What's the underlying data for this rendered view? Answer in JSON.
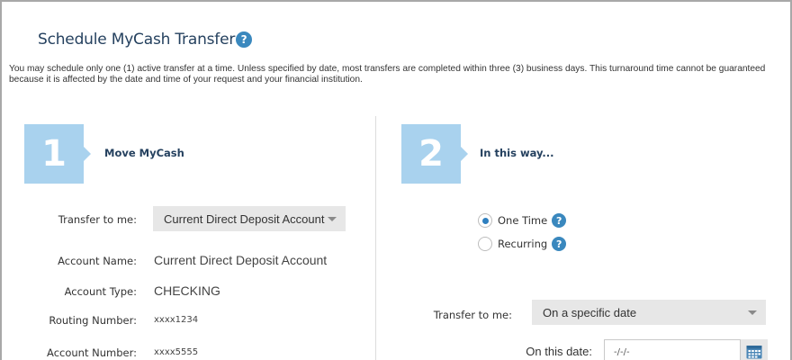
{
  "header": {
    "title": "Schedule MyCash Transfer",
    "help_glyph": "?"
  },
  "notice": "You may schedule only one (1) active transfer at a time. Unless specified by date, most transfers are completed within three (3) business days. This turnaround time cannot be guaranteed because it is affected by the date and time of your request and your financial institution.",
  "step1": {
    "number": "1",
    "title": "Move MyCash",
    "transfer_label": "Transfer to me:",
    "transfer_value": "Current Direct Deposit Account",
    "account_name_label": "Account Name:",
    "account_name_value": "Current Direct Deposit Account",
    "account_type_label": "Account Type:",
    "account_type_value": "CHECKING",
    "routing_label": "Routing Number:",
    "routing_value": "xxxx1234",
    "account_number_label": "Account Number:",
    "account_number_value": "xxxx5555"
  },
  "step2": {
    "number": "2",
    "title": "In this way...",
    "one_time_label": "One Time",
    "recurring_label": "Recurring",
    "selected_frequency": "One Time",
    "transfer_label": "Transfer to me:",
    "transfer_value": "On a specific date",
    "date_label": "On this date:",
    "date_value": "-/-/-"
  },
  "colors": {
    "accent": "#3a88be",
    "step_box": "#a9d2ee",
    "title": "#25415f",
    "select_bg": "#e7e7e7"
  },
  "icons": {
    "help": "help-icon",
    "calendar": "calendar-icon",
    "dropdown": "chevron-down-icon"
  }
}
